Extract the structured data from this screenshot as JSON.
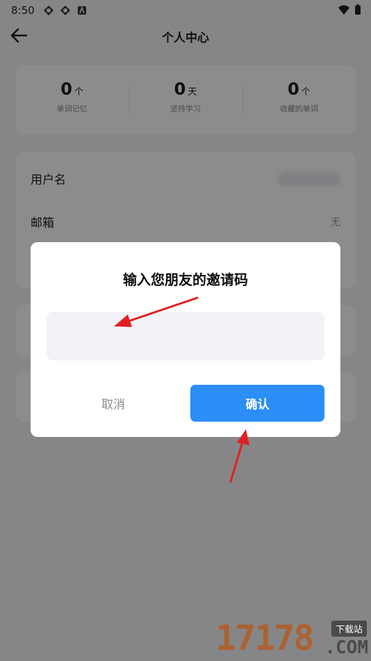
{
  "status_bar": {
    "time": "8:50"
  },
  "header": {
    "title": "个人中心"
  },
  "stats": [
    {
      "value": "0",
      "unit": "个",
      "label": "单词记忆"
    },
    {
      "value": "0",
      "unit": "天",
      "label": "坚持学习"
    },
    {
      "value": "0",
      "unit": "个",
      "label": "收藏的单词"
    }
  ],
  "profile": {
    "username_label": "用户名",
    "email_label": "邮箱",
    "email_value": "无"
  },
  "dialog": {
    "title": "输入您朋友的邀请码",
    "input_value": "",
    "cancel_label": "取消",
    "confirm_label": "确认"
  },
  "watermark": {
    "number": "17178",
    "site": "下载站",
    "domain": ".COM"
  },
  "colors": {
    "accent": "#2b8ef6",
    "overlay": "rgba(0,0,0,0.45)",
    "arrow": "#e02020"
  }
}
